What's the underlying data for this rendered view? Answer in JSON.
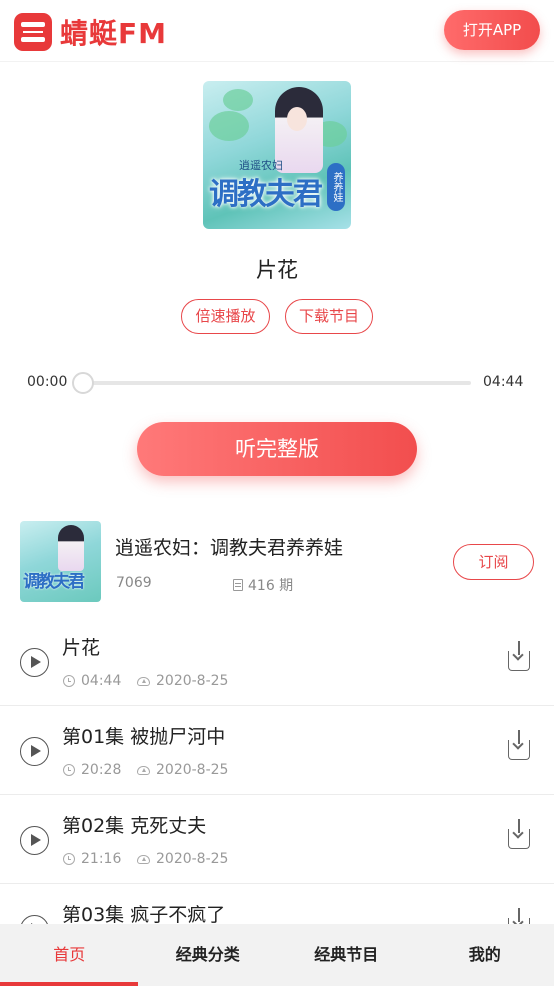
{
  "header": {
    "logo_text": "蜻蜓FM",
    "open_app": "打开APP"
  },
  "cover": {
    "small_title": "逍遥农妇",
    "big_title": "调教夫君",
    "seal_text": "养养娃"
  },
  "episode": {
    "title": "片花",
    "speed_button": "倍速播放",
    "download_button": "下载节目"
  },
  "player": {
    "current_time": "00:00",
    "total_time": "04:44",
    "progress": 0,
    "listen_full": "听完整版"
  },
  "album": {
    "title": "逍遥农妇：调教夫君养养娃",
    "plays": "7069",
    "episode_count": "416 期",
    "subscribe": "订阅",
    "thumb_title": "调教夫君"
  },
  "episodes": [
    {
      "name": "片花",
      "duration": "04:44",
      "date": "2020-8-25"
    },
    {
      "name": "第01集 被抛尸河中",
      "duration": "20:28",
      "date": "2020-8-25"
    },
    {
      "name": "第02集 克死丈夫",
      "duration": "21:16",
      "date": "2020-8-25"
    },
    {
      "name": "第03集 疯子不疯了",
      "duration": "",
      "date": ""
    }
  ],
  "bottom_nav": [
    {
      "label": "首页",
      "active": true
    },
    {
      "label": "经典分类",
      "active": false
    },
    {
      "label": "经典节目",
      "active": false
    },
    {
      "label": "我的",
      "active": false
    }
  ],
  "colors": {
    "brand": "#e8393a",
    "accent_gradient_start": "#ff7979",
    "accent_gradient_end": "#f24e4e"
  }
}
